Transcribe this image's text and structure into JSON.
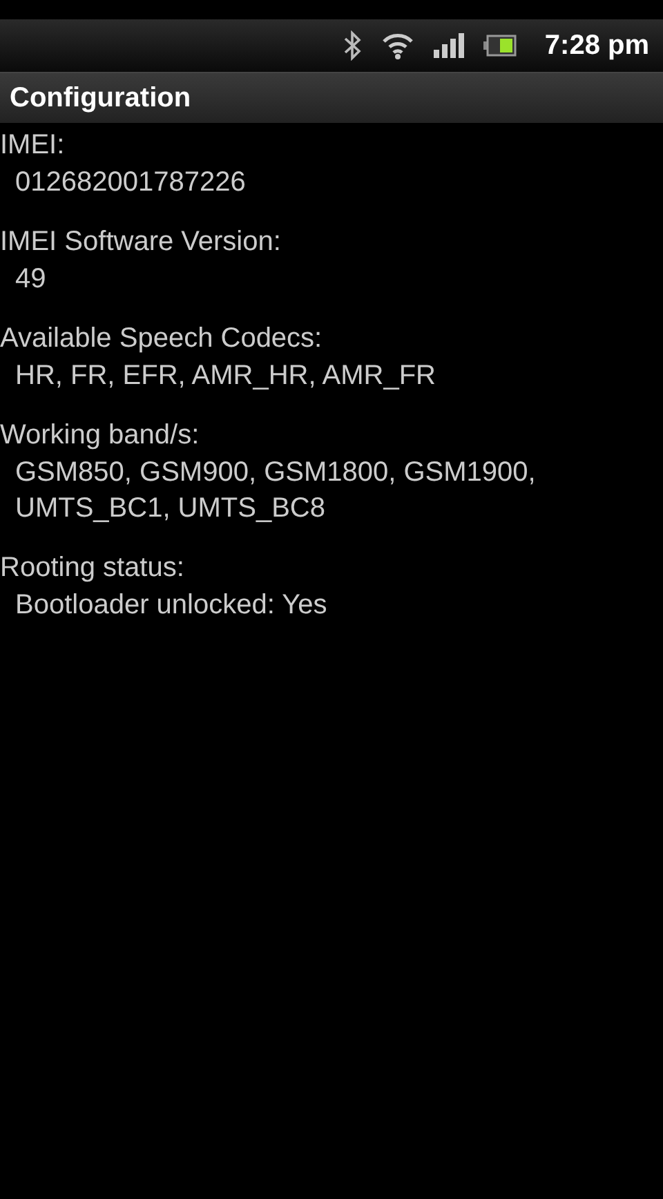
{
  "status_bar": {
    "time": "7:28 pm"
  },
  "title": "Configuration",
  "sections": [
    {
      "label": "IMEI:",
      "value": "012682001787226"
    },
    {
      "label": "IMEI Software Version:",
      "value": "49"
    },
    {
      "label": "Available Speech Codecs:",
      "value": "HR, FR, EFR, AMR_HR, AMR_FR"
    },
    {
      "label": "Working band/s:",
      "value": "GSM850, GSM900, GSM1800, GSM1900, UMTS_BC1, UMTS_BC8"
    },
    {
      "label": "Rooting status:",
      "value": "Bootloader unlocked: Yes"
    }
  ]
}
